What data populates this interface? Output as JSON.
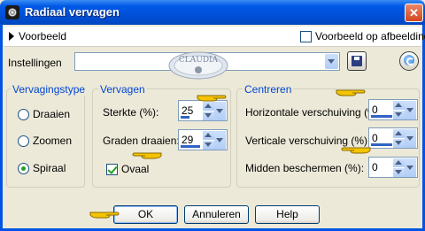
{
  "window": {
    "title": "Radiaal vervagen",
    "close_glyph": "✕",
    "icon": "app-radial-icon"
  },
  "preview": {
    "label": "Voorbeeld",
    "on_image_label": "Voorbeeld op afbeelding",
    "on_image_checked": false
  },
  "settings": {
    "label": "Instellingen",
    "value": ""
  },
  "watermark": {
    "text": "CLAUDIA"
  },
  "blur_type": {
    "title": "Vervagingstype",
    "options": [
      {
        "label": "Draaien",
        "selected": false
      },
      {
        "label": "Zoomen",
        "selected": false
      },
      {
        "label": "Spiraal",
        "selected": true
      }
    ]
  },
  "blur": {
    "title": "Vervagen",
    "strength_label": "Sterkte (%):",
    "strength_value": "25",
    "degrees_label": "Graden draaien:",
    "degrees_value": "29",
    "oval_label": "Ovaal",
    "oval_checked": true
  },
  "center": {
    "title": "Centreren",
    "h_offset_label": "Horizontale verschuiving (%):",
    "h_offset_value": "0",
    "v_offset_label": "Verticale verschuiving (%):",
    "v_offset_value": "0",
    "protect_label": "Midden beschermen (%):",
    "protect_value": "0"
  },
  "buttons": {
    "ok": "OK",
    "cancel": "Annuleren",
    "help": "Help"
  },
  "colors": {
    "title_bar": "#0054e3",
    "group_title": "#0046d5",
    "spin_bar": "#3163c5",
    "pointer_hand": "#f5c400"
  }
}
